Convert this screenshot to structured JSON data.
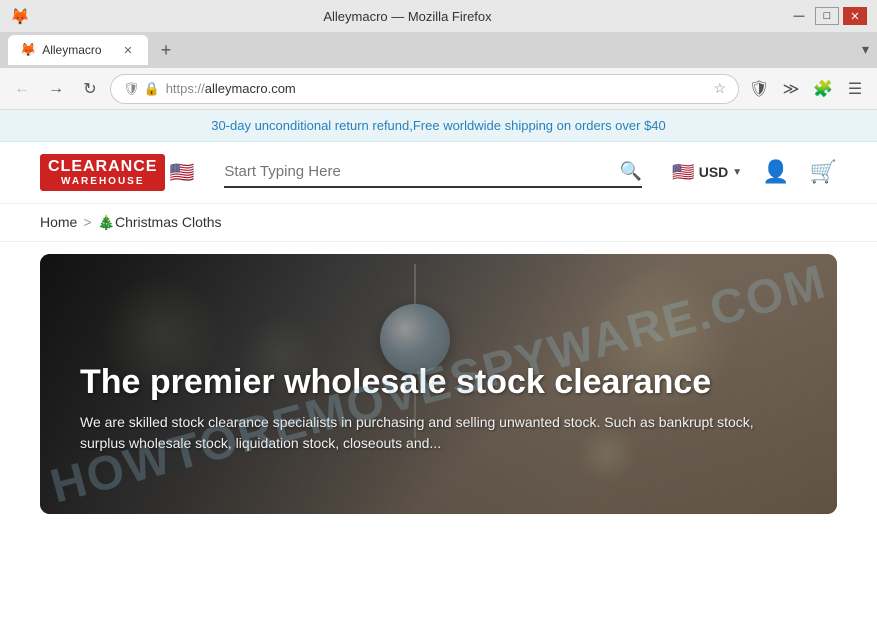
{
  "browser": {
    "title": "Alleymacro — Mozilla Firefox",
    "tab_title": "Alleymacro",
    "url_protocol": "https://",
    "url_domain": "alleymacro.com",
    "new_tab_label": "+",
    "chevron_label": "▾"
  },
  "promo_banner": {
    "text": "30-day unconditional return refund,Free worldwide shipping on orders over $40"
  },
  "header": {
    "logo_line1": "CLEARANCE",
    "logo_line2": "WAREHOUSE",
    "logo_flag": "🇺🇸",
    "search_placeholder": "Start Typing Here",
    "currency": "USD",
    "currency_flag": "🇺🇸"
  },
  "breadcrumb": {
    "home": "Home",
    "separator": ">",
    "current": "🎄Christmas Cloths"
  },
  "hero": {
    "title": "The premier wholesale stock clearance",
    "subtitle": "We are skilled stock clearance specialists in purchasing and selling unwanted stock. Such as bankrupt stock, surplus wholesale stock, liquidation stock, closeouts and..."
  },
  "watermark": {
    "text": "HOWTOREMOVESPYWARE.COM"
  },
  "icons": {
    "back": "←",
    "forward": "→",
    "refresh": "↻",
    "shield": "🛡",
    "lock": "🔒",
    "bookmark": "☆",
    "extensions": "≫",
    "puzzle": "🧩",
    "hamburger": "☰",
    "search": "🔍",
    "user": "👤",
    "cart": "🛒",
    "firefox": "🦊",
    "minimize": "—",
    "maximize": "□",
    "close": "✕"
  }
}
